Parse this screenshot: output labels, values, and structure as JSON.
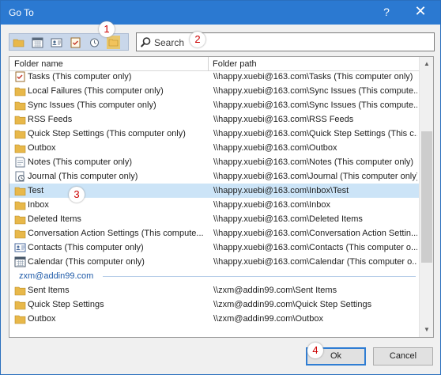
{
  "window": {
    "title": "Go To",
    "help_label": "?",
    "close_label": "✕"
  },
  "toolbar": {
    "buttons": [
      {
        "name": "mail-folder-icon",
        "color": "#e8b84a"
      },
      {
        "name": "calendar-icon",
        "color": "#6b7b8c"
      },
      {
        "name": "contacts-icon",
        "color": "#6b7b8c"
      },
      {
        "name": "tasks-icon",
        "color": "#c47a2a"
      },
      {
        "name": "journal-icon",
        "color": "#6b7b8c"
      },
      {
        "name": "folder-list-icon",
        "color": "#e8b84a"
      }
    ]
  },
  "search": {
    "placeholder": "Search"
  },
  "badges": {
    "b1": "1",
    "b2": "2",
    "b3": "3",
    "b4": "4"
  },
  "list": {
    "col_name": "Folder name",
    "col_path": "Folder path",
    "rows": [
      {
        "icon": "tasks",
        "name": "Tasks (This computer only)",
        "path": "\\\\happy.xuebi@163.com\\Tasks (This computer only)"
      },
      {
        "icon": "folder",
        "name": "Local Failures (This computer only)",
        "path": "\\\\happy.xuebi@163.com\\Sync Issues (This compute..."
      },
      {
        "icon": "folder",
        "name": "Sync Issues (This computer only)",
        "path": "\\\\happy.xuebi@163.com\\Sync Issues (This compute..."
      },
      {
        "icon": "folder",
        "name": "RSS Feeds",
        "path": "\\\\happy.xuebi@163.com\\RSS Feeds"
      },
      {
        "icon": "folder",
        "name": "Quick Step Settings (This computer only)",
        "path": "\\\\happy.xuebi@163.com\\Quick Step Settings (This c..."
      },
      {
        "icon": "folder",
        "name": "Outbox",
        "path": "\\\\happy.xuebi@163.com\\Outbox"
      },
      {
        "icon": "notes",
        "name": "Notes (This computer only)",
        "path": "\\\\happy.xuebi@163.com\\Notes (This computer only)"
      },
      {
        "icon": "journal",
        "name": "Journal (This computer only)",
        "path": "\\\\happy.xuebi@163.com\\Journal (This computer only)"
      },
      {
        "icon": "folder",
        "name": "Test",
        "path": "\\\\happy.xuebi@163.com\\Inbox\\Test",
        "selected": true
      },
      {
        "icon": "folder",
        "name": "Inbox",
        "path": "\\\\happy.xuebi@163.com\\Inbox"
      },
      {
        "icon": "folder",
        "name": "Deleted Items",
        "path": "\\\\happy.xuebi@163.com\\Deleted Items"
      },
      {
        "icon": "folder",
        "name": "Conversation Action Settings (This compute...",
        "path": "\\\\happy.xuebi@163.com\\Conversation Action Settin..."
      },
      {
        "icon": "contacts",
        "name": "Contacts (This computer only)",
        "path": "\\\\happy.xuebi@163.com\\Contacts (This computer o..."
      },
      {
        "icon": "calendar",
        "name": "Calendar (This computer only)",
        "path": "\\\\happy.xuebi@163.com\\Calendar (This computer o..."
      },
      {
        "group": "zxm@addin99.com"
      },
      {
        "icon": "folder",
        "name": "Sent Items",
        "path": "\\\\zxm@addin99.com\\Sent Items"
      },
      {
        "icon": "folder",
        "name": "Quick Step Settings",
        "path": "\\\\zxm@addin99.com\\Quick Step Settings"
      },
      {
        "icon": "folder",
        "name": "Outbox",
        "path": "\\\\zxm@addin99.com\\Outbox"
      }
    ]
  },
  "scrollbar": {
    "up": "▲",
    "down": "▼"
  },
  "buttons": {
    "ok": "Ok",
    "cancel": "Cancel"
  },
  "colors": {
    "titlebar": "#2b79d1",
    "selection": "#cce4f7",
    "folder": "#e8b84a",
    "badge_text": "#cc0000"
  }
}
